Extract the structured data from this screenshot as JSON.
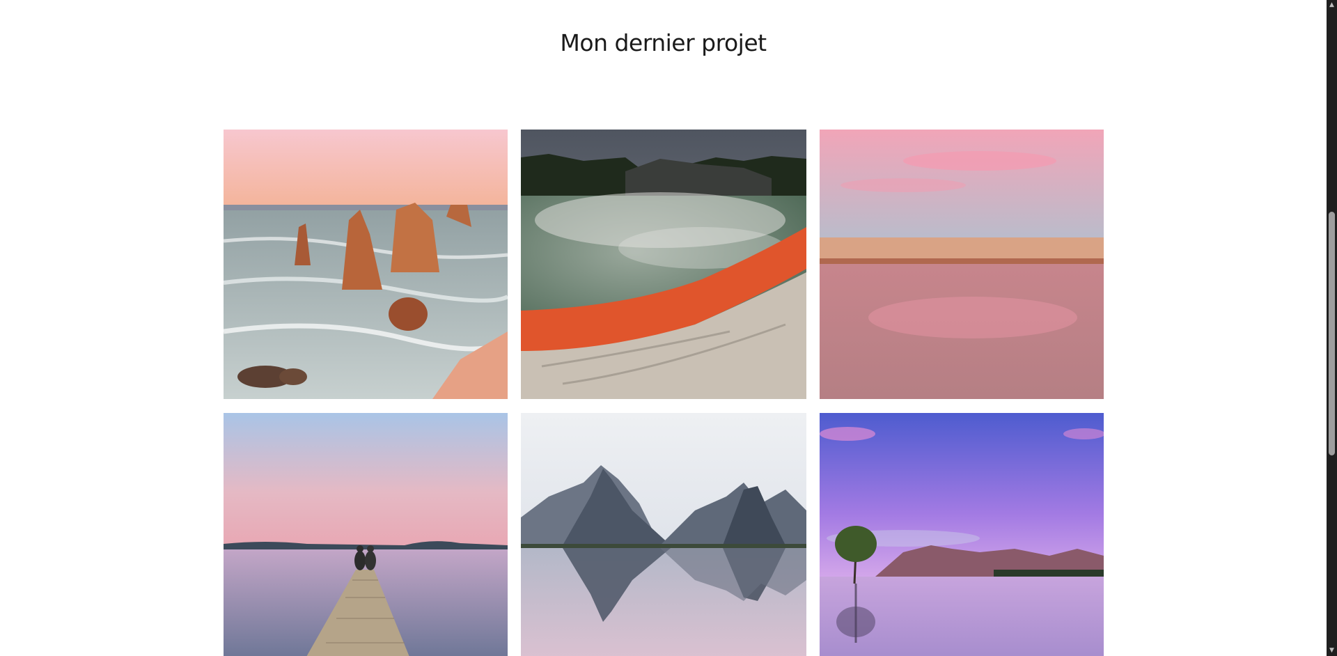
{
  "section": {
    "title": "Mon dernier projet"
  },
  "gallery": {
    "photos": [
      {
        "subject": "coastal sea stacks at sunset",
        "accent": "#d87a45"
      },
      {
        "subject": "steaming geothermal lake with orange edge",
        "accent": "#e0552c"
      },
      {
        "subject": "pink sky reflected on beach water",
        "accent": "#e58a98"
      },
      {
        "subject": "couple sitting on wooden pier at dusk",
        "accent": "#b89ab8"
      },
      {
        "subject": "mountain peaks reflected in lake",
        "accent": "#6b7a8c"
      },
      {
        "subject": "lone tree in purple lake",
        "accent": "#9a6fd0"
      }
    ]
  },
  "scrollbar": {
    "up_arrow": "▲",
    "down_arrow": "▼"
  }
}
